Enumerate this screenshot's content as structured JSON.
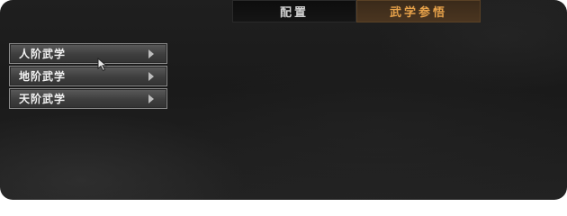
{
  "tabs": [
    {
      "label": "配置",
      "active": false
    },
    {
      "label": "武学参悟",
      "active": true
    }
  ],
  "menu": {
    "items": [
      {
        "label": "人阶武学"
      },
      {
        "label": "地阶武学"
      },
      {
        "label": "天阶武学"
      }
    ]
  },
  "colors": {
    "active_tab_text": "#e7a24a",
    "active_tab_bg": "#4a3520"
  },
  "icons": [
    "chevron-right-icon",
    "mouse-cursor-icon"
  ]
}
